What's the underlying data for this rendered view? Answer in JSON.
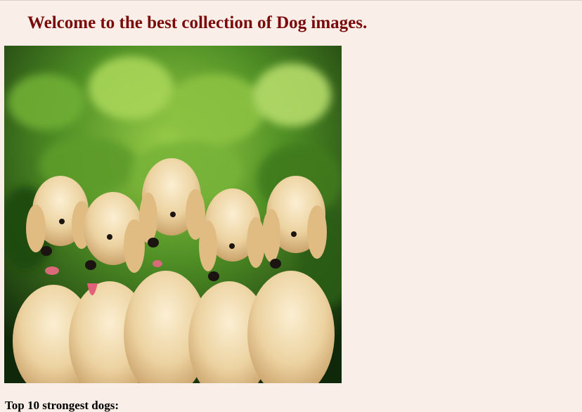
{
  "page": {
    "heading": "Welcome to the best collection of Dog images.",
    "heading_color": "#7a0a0a",
    "background_color": "#faefe8"
  },
  "image": {
    "alt": "dog-photo"
  },
  "section": {
    "label": "Top 10 strongest dogs:"
  }
}
